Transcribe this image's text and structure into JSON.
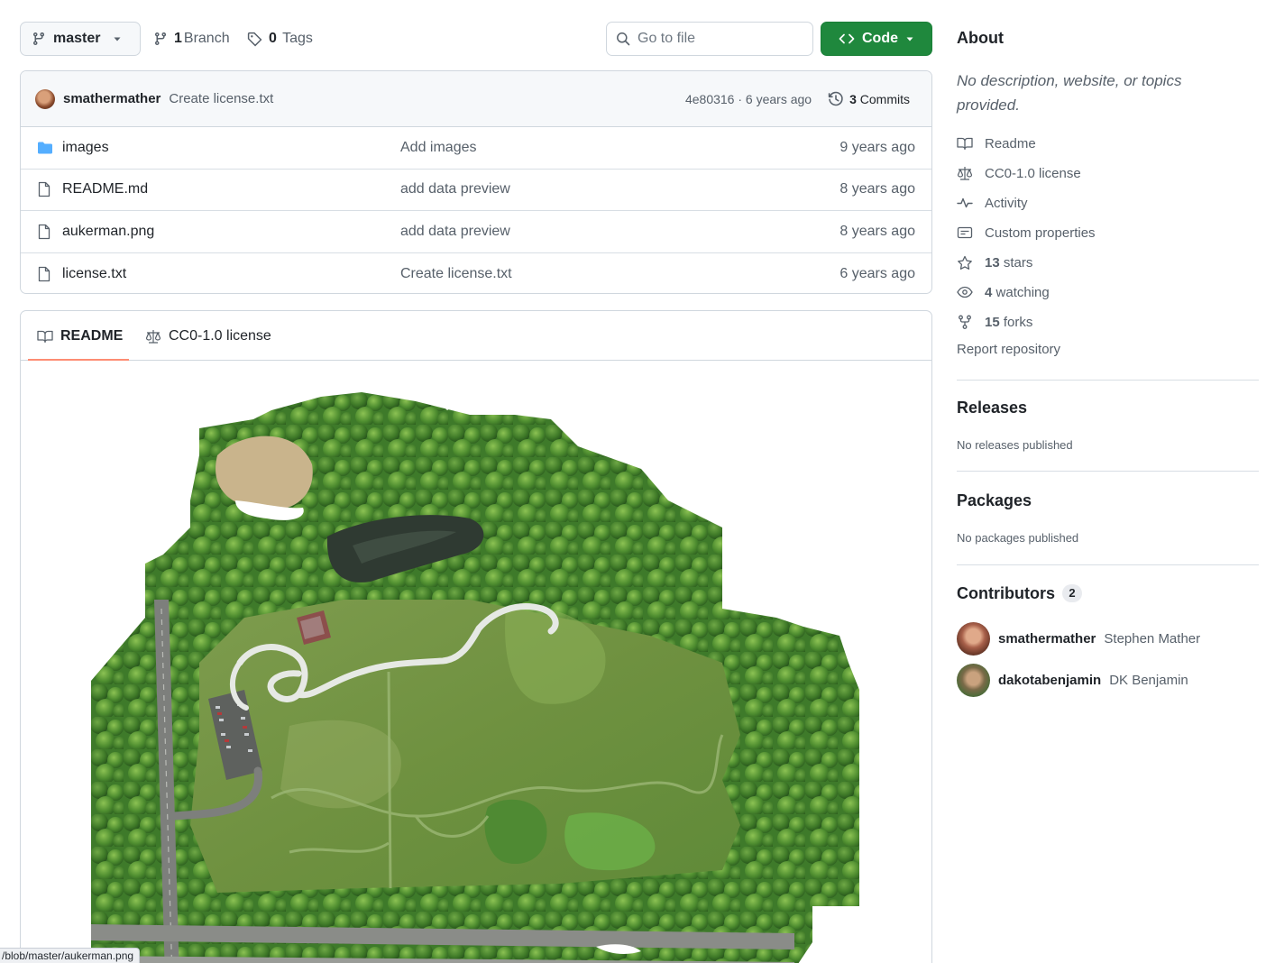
{
  "toolbar": {
    "branch_name": "master",
    "branch_count": "1",
    "branch_label": "Branch",
    "tag_count": "0",
    "tag_label": "Tags",
    "go_to_file_placeholder": "Go to file",
    "code_label": "Code"
  },
  "latest_commit": {
    "author": "smathermather",
    "message": "Create license.txt",
    "hash_and_time": "4e80316 · 6 years ago",
    "commit_count": "3",
    "commit_label": "Commits"
  },
  "files": [
    {
      "name": "images",
      "type": "folder",
      "message": "Add images",
      "date": "9 years ago"
    },
    {
      "name": "README.md",
      "type": "file",
      "message": "add data preview",
      "date": "8 years ago"
    },
    {
      "name": "aukerman.png",
      "type": "file",
      "message": "add data preview",
      "date": "8 years ago"
    },
    {
      "name": "license.txt",
      "type": "file",
      "message": "Create license.txt",
      "date": "6 years ago"
    }
  ],
  "readme": {
    "tab_readme": "README",
    "tab_license": "CC0-1.0 license"
  },
  "status_bar_url": "/blob/master/aukerman.png",
  "about": {
    "title": "About",
    "description": "No description, website, or topics provided.",
    "items": [
      {
        "icon": "book-icon",
        "label": "Readme"
      },
      {
        "icon": "scale-icon",
        "label": "CC0-1.0 license"
      },
      {
        "icon": "pulse-icon",
        "label": "Activity"
      },
      {
        "icon": "note-icon",
        "label": "Custom properties"
      },
      {
        "icon": "star-icon",
        "count": "13",
        "label": "stars"
      },
      {
        "icon": "eye-icon",
        "count": "4",
        "label": "watching"
      },
      {
        "icon": "fork-icon",
        "count": "15",
        "label": "forks"
      }
    ],
    "report": "Report repository"
  },
  "releases": {
    "title": "Releases",
    "empty": "No releases published"
  },
  "packages": {
    "title": "Packages",
    "empty": "No packages published"
  },
  "contributors": {
    "title": "Contributors",
    "count": "2",
    "people": [
      {
        "login": "smathermather",
        "name": "Stephen Mather"
      },
      {
        "login": "dakotabenjamin",
        "name": "DK Benjamin"
      }
    ]
  },
  "colors": {
    "accent_green": "#1f883d",
    "tab_underline": "#fd8c73",
    "folder_blue": "#54aeff"
  }
}
